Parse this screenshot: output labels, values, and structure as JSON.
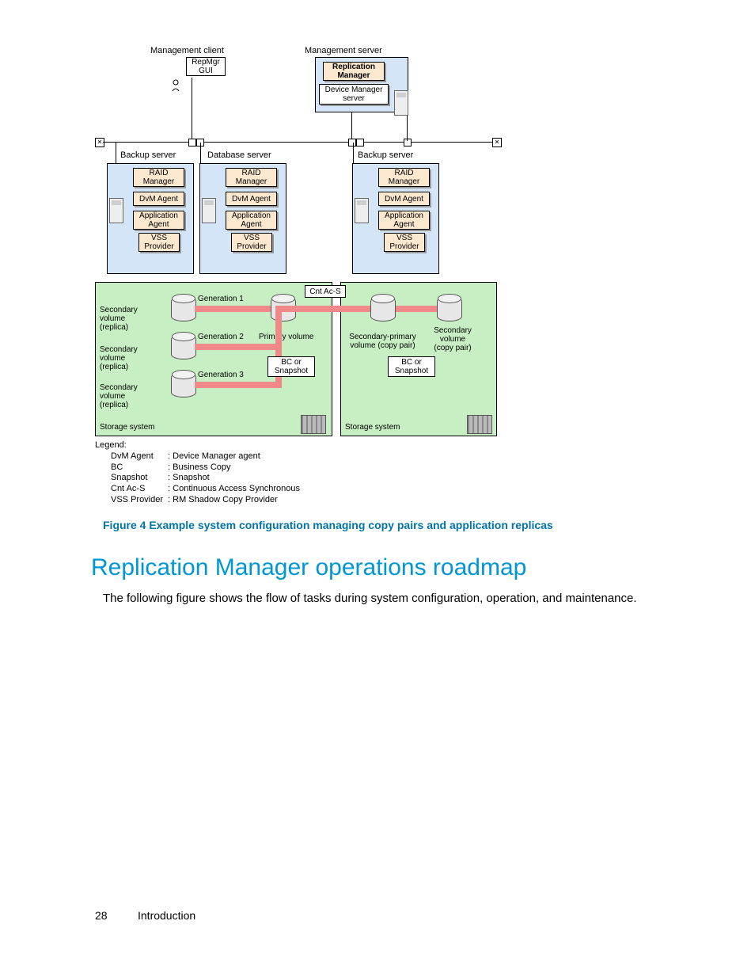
{
  "diagram": {
    "top": {
      "management_client": "Management client",
      "repmgr_gui": "RepMgr",
      "repmgr_gui2": "GUI",
      "management_server": "Management server",
      "replication_manager": "Replication",
      "replication_manager2": "Manager",
      "device_manager_server": "Device Manager",
      "device_manager_server2": "server"
    },
    "servers": {
      "backup_server": "Backup server",
      "database_server": "Database server",
      "raid_manager": "RAID",
      "raid_manager2": "Manager",
      "dvm_agent": "DvM Agent",
      "application_agent": "Application",
      "application_agent2": "Agent",
      "vss_provider": "VSS",
      "vss_provider2": "Provider"
    },
    "storage": {
      "secondary_volume": "Secondary",
      "secondary_volume2": "volume",
      "replica": "(replica)",
      "generation1": "Generation 1",
      "generation2": "Generation 2",
      "generation3": "Generation 3",
      "primary_volume": "Primary volume",
      "cnt_ac_s": "Cnt Ac-S",
      "secondary_primary": "Secondary-primary",
      "secondary_primary2": "volume (copy pair)",
      "secondary_copy": "Secondary",
      "secondary_copy2": "volume",
      "secondary_copy3": "(copy pair)",
      "bc_or": "BC or",
      "snapshot": "Snapshot",
      "storage_system": "Storage system"
    },
    "legend": {
      "title": "Legend:",
      "rows": [
        {
          "k": "DvM Agent",
          "v": ": Device Manager agent"
        },
        {
          "k": "BC",
          "v": ": Business Copy"
        },
        {
          "k": "Snapshot",
          "v": ": Snapshot"
        },
        {
          "k": "Cnt Ac-S",
          "v": ": Continuous Access Synchronous"
        },
        {
          "k": "VSS Provider",
          "v": ": RM Shadow Copy Provider"
        }
      ]
    }
  },
  "caption": "Figure 4 Example system configuration managing copy pairs and application replicas",
  "heading": "Replication Manager operations roadmap",
  "body": "The following figure shows the flow of tasks during system configuration, operation, and maintenance.",
  "page_number": "28",
  "chapter": "Introduction"
}
